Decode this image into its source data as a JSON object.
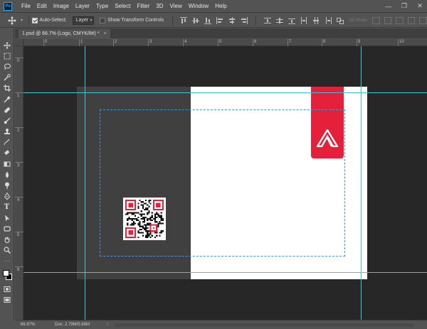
{
  "app": {
    "logo_text": "Ps",
    "menu": [
      "File",
      "Edit",
      "Image",
      "Layer",
      "Type",
      "Select",
      "Filter",
      "3D",
      "View",
      "Window",
      "Help"
    ],
    "window_controls": [
      "—",
      "❐",
      "✕"
    ]
  },
  "options_bar": {
    "auto_select_label": "Auto-Select:",
    "auto_select_checked": true,
    "target_value": "Layer",
    "show_transform_label": "Show Transform Controls",
    "show_transform_checked": false,
    "mode_3d_label": "3D Mode:"
  },
  "document": {
    "tab_title": "1.psd @ 66.7% (Logo, CMYK/8#) *",
    "close_glyph": "×"
  },
  "rulers": {
    "horizontal_ticks": [
      "0",
      "1",
      "2",
      "3",
      "4",
      "5",
      "6",
      "7",
      "8",
      "9",
      "10"
    ],
    "vertical_ticks": [
      "0",
      "1",
      "2",
      "3",
      "4",
      "5",
      "6"
    ]
  },
  "status": {
    "zoom": "66.67%",
    "doc_size": "Doc: 2.79M/5.65M",
    "arrow": "›"
  },
  "colors": {
    "accent_red": "#e4203a",
    "guide": "#3ec5d6",
    "bleed_dash": "#4f8fd6",
    "pasteboard": "#272727",
    "panel": "#535353"
  }
}
